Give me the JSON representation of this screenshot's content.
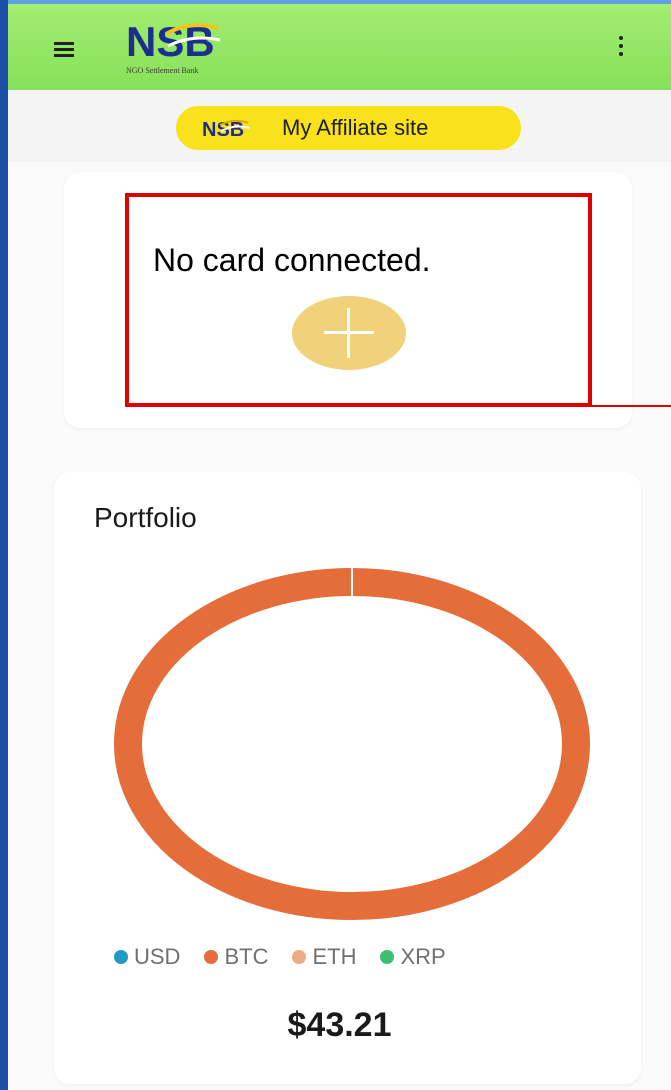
{
  "header": {
    "logo_text": "NSB",
    "logo_subtitle": "NGO Settlement Bank",
    "menu_icon": "hamburger-menu-icon",
    "more_icon": "more-vertical-icon"
  },
  "affiliate": {
    "label": "My Affiliate site",
    "logo_text": "NSB"
  },
  "card_section": {
    "message": "No card connected.",
    "add_icon": "plus-icon"
  },
  "portfolio": {
    "title": "Portfolio",
    "total": "$43.21",
    "legend": [
      {
        "name": "USD",
        "color": "#1f9bc4"
      },
      {
        "name": "BTC",
        "color": "#e46d3a"
      },
      {
        "name": "ETH",
        "color": "#eeaa86"
      },
      {
        "name": "XRP",
        "color": "#3cbf75"
      }
    ]
  },
  "colors": {
    "header": "#8ce25e",
    "affiliate": "#f9e11c",
    "add_button": "#efd27b",
    "highlight": "#e00000"
  },
  "chart_data": {
    "type": "pie",
    "categories": [
      "USD",
      "BTC",
      "ETH",
      "XRP"
    ],
    "values": [
      0,
      100,
      0,
      0
    ],
    "title": "Portfolio"
  }
}
